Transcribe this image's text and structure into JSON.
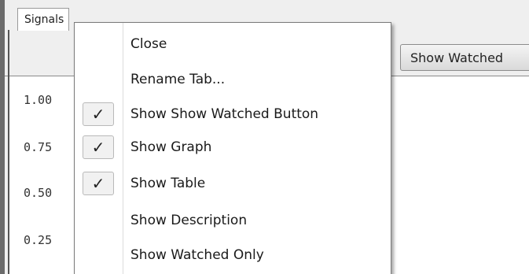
{
  "tab": {
    "label": "Signals"
  },
  "toolbar": {
    "show_watched_button": "Show Watched"
  },
  "graph": {
    "y_ticks": [
      "1.00",
      "0.75",
      "0.50",
      "0.25"
    ]
  },
  "context_menu": {
    "items": [
      {
        "label": "Close",
        "checked": false
      },
      {
        "label": "Rename Tab...",
        "checked": false
      },
      {
        "label": "Show Show Watched Button",
        "checked": true
      },
      {
        "label": "Show Graph",
        "checked": true
      },
      {
        "label": "Show Table",
        "checked": true
      },
      {
        "label": "Show Description",
        "checked": false
      },
      {
        "label": "Show Watched Only",
        "checked": false
      }
    ],
    "check_glyph": "✓"
  }
}
